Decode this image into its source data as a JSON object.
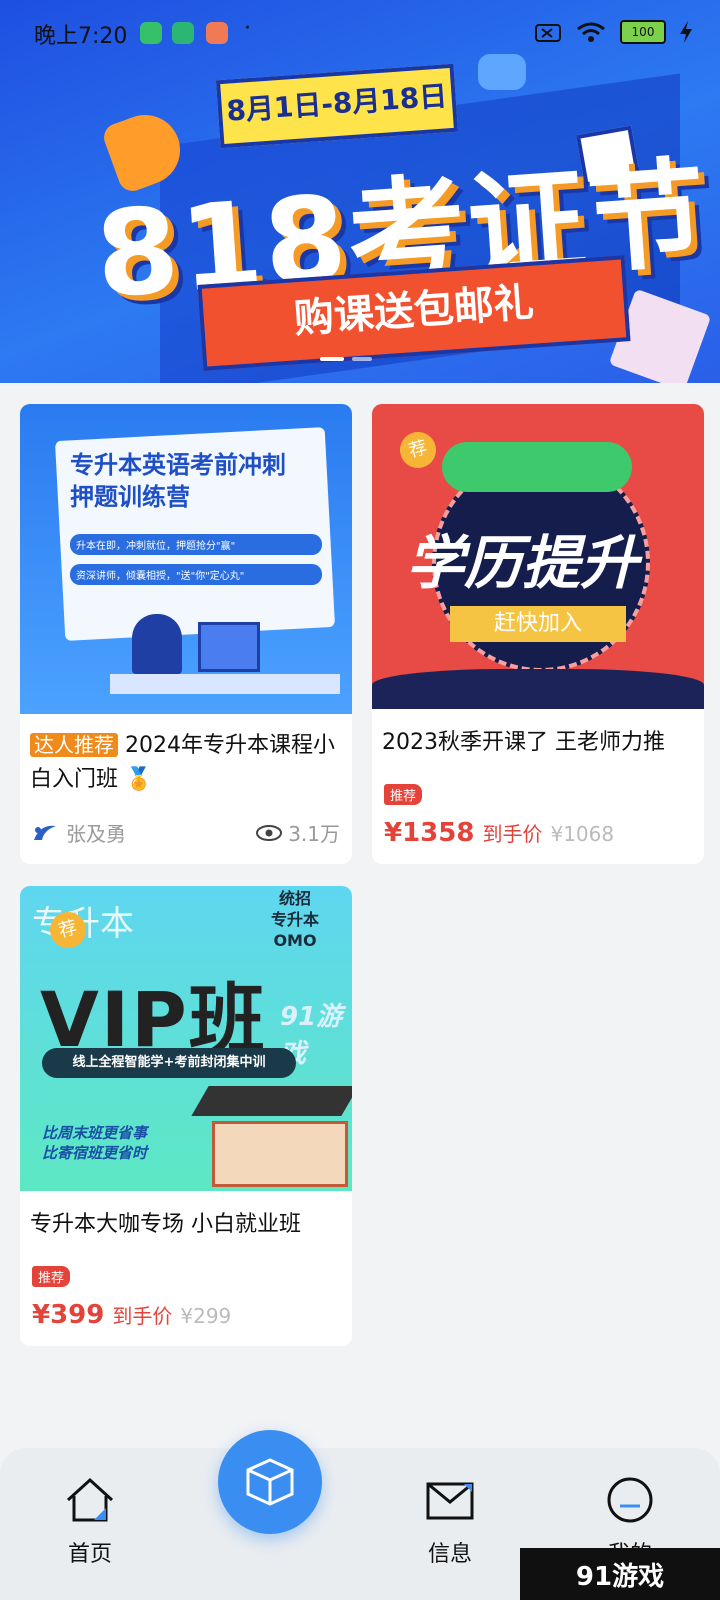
{
  "status_bar": {
    "time": "晚上7:20",
    "battery": "100",
    "dot": "·"
  },
  "banner": {
    "date_range": "8月1日-8月18日",
    "headline": "818考证节",
    "ribbon_text": "购课送包邮礼"
  },
  "courses": [
    {
      "thumb_title": "专升本英语考前冲刺押题训练营",
      "thumb_line1": "升本在即，冲刺就位，押题抢分\"赢\"",
      "thumb_line2": "资深讲师，倾囊相授，\"送\"你\"定心丸\"",
      "tag": "达人推荐",
      "title": "2024年专升本课程小白入门班",
      "medal": "🏅",
      "author": "张及勇",
      "views": "3.1万"
    },
    {
      "badge": "荐",
      "thumb_word": "学历提升",
      "thumb_join": "赶快加入",
      "title": "2023秋季开课了 王老师力推",
      "rec_label": "推荐",
      "price": "¥1358",
      "price_label": "到手价",
      "orig_price": "¥1068"
    },
    {
      "badge": "荐",
      "thumb_corner": "专升本",
      "thumb_omo": [
        "统招",
        "专升本",
        "OMO"
      ],
      "thumb_vip": "VIP班",
      "thumb_bar": "线上全程智能学+考前封闭集中训",
      "thumb_line1": "比周末班更省事",
      "thumb_line2": "比寄宿班更省时",
      "thumb_watermark": "91游戏",
      "title": "专升本大咖专场 小白就业班",
      "rec_label": "推荐",
      "price": "¥399",
      "price_label": "到手价",
      "orig_price": "¥299"
    }
  ],
  "nav": {
    "home": "首页",
    "messages": "信息",
    "mine": "我的"
  },
  "watermark": "91游戏"
}
